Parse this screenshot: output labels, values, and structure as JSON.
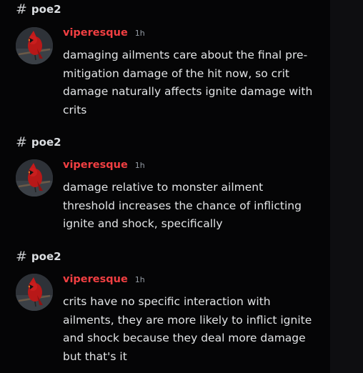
{
  "messages": [
    {
      "channel": "poe2",
      "username": "viperesque",
      "timestamp": "1h",
      "text": "damaging ailments care about the final pre-mitigation damage of the hit now, so crit damage naturally affects ignite damage with crits"
    },
    {
      "channel": "poe2",
      "username": "viperesque",
      "timestamp": "1h",
      "text": "damage relative to monster ailment threshold increases the chance of inflicting ignite and shock, specifically"
    },
    {
      "channel": "poe2",
      "username": "viperesque",
      "timestamp": "1h",
      "text": "crits have no specific interaction with ailments, they are more likely to inflict ignite and shock because they deal more damage but that's it"
    }
  ],
  "colors": {
    "username": "#f23f42",
    "timestamp": "#949ba4",
    "text": "#e2e4e6",
    "background": "#050506"
  },
  "icons": {
    "channel": "hash-icon",
    "avatar": "cardinal-avatar"
  }
}
